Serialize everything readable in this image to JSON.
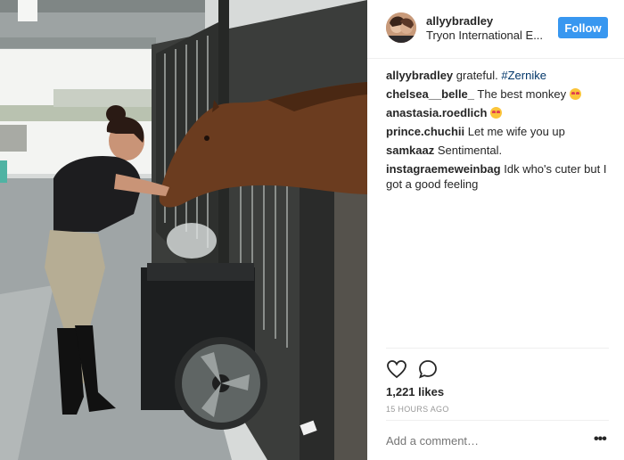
{
  "post": {
    "username": "allyybradley",
    "location": "Tryon International E...",
    "follow_label": "Follow"
  },
  "comments": [
    {
      "user": "allyybradley",
      "text": "grateful. ",
      "hashtag": "#Zernike"
    },
    {
      "user": "chelsea__belle_",
      "text": "The best monkey",
      "emoji": "heart-eyes-emoji"
    },
    {
      "user": "anastasia.roedlich",
      "text": "",
      "emoji": "heart-eyes-emoji"
    },
    {
      "user": "prince.chuchii",
      "text": "Let me wife you up"
    },
    {
      "user": "samkaaz",
      "text": "Sentimental."
    },
    {
      "user": "instagraemeweinbag",
      "text": "Idk who's cuter but I got a good feeling"
    }
  ],
  "actions": {
    "like_icon": "heart-icon",
    "comment_icon": "comment-icon"
  },
  "likes": "1,221 likes",
  "timestamp": "15 HOURS AGO",
  "add_comment_placeholder": "Add a comment…",
  "more_label": "•••",
  "colors": {
    "follow_button": "#3897f0",
    "hashtag": "#003569",
    "muted": "#999999"
  }
}
